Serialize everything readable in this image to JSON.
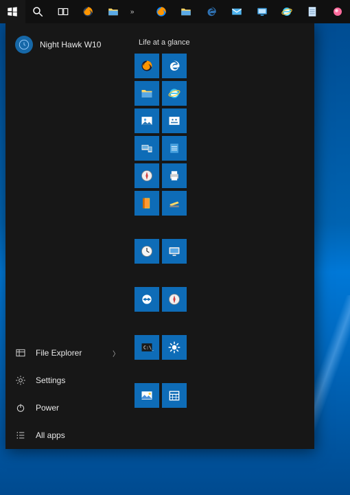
{
  "taskbar": {
    "items": [
      {
        "name": "start-button",
        "icon": "windows"
      },
      {
        "name": "search-button",
        "icon": "search"
      },
      {
        "name": "taskview-button",
        "icon": "taskview"
      }
    ],
    "apps": [
      {
        "name": "tb-firefox",
        "icon": "firefox"
      },
      {
        "name": "tb-fileexplorer",
        "icon": "folder"
      }
    ],
    "overflow": "»",
    "pinned": [
      {
        "name": "tb-firefox-2",
        "icon": "firefox-blue"
      },
      {
        "name": "tb-fileexplorer-2",
        "icon": "folder"
      },
      {
        "name": "tb-edge",
        "icon": "edge"
      },
      {
        "name": "tb-mail",
        "icon": "mail"
      },
      {
        "name": "tb-monitor",
        "icon": "monitor"
      },
      {
        "name": "tb-ie",
        "icon": "ie"
      },
      {
        "name": "tb-notes",
        "icon": "notepad"
      },
      {
        "name": "tb-util",
        "icon": "orb"
      }
    ]
  },
  "start": {
    "user": "Night Hawk W10",
    "items": {
      "fileExplorer": "File Explorer",
      "settings": "Settings",
      "power": "Power",
      "allApps": "All apps"
    },
    "groupTitle": "Life at a glance",
    "tiles": [
      [
        {
          "name": "tile-firefox",
          "icon": "firefox-dark"
        },
        {
          "name": "tile-edge",
          "icon": "edge"
        }
      ],
      [
        {
          "name": "tile-fileexplorer",
          "icon": "folder"
        },
        {
          "name": "tile-ie",
          "icon": "ie"
        }
      ],
      [
        {
          "name": "tile-photos",
          "icon": "photos"
        },
        {
          "name": "tile-control",
          "icon": "control"
        }
      ],
      [
        {
          "name": "tile-devices",
          "icon": "devices"
        },
        {
          "name": "tile-notepadblue",
          "icon": "notepadblue"
        }
      ],
      [
        {
          "name": "tile-compass",
          "icon": "compass"
        },
        {
          "name": "tile-printer",
          "icon": "printer"
        }
      ],
      [
        {
          "name": "tile-book",
          "icon": "book"
        },
        {
          "name": "tile-stapler",
          "icon": "stapler"
        }
      ],
      "gap",
      [
        {
          "name": "tile-clock",
          "icon": "clock"
        },
        {
          "name": "tile-monitor",
          "icon": "monitorwhite"
        }
      ],
      "gap",
      [
        {
          "name": "tile-teamviewer",
          "icon": "teamviewer"
        },
        {
          "name": "tile-compass2",
          "icon": "compass"
        }
      ],
      "gap",
      [
        {
          "name": "tile-cmd",
          "icon": "cmd"
        },
        {
          "name": "tile-weather",
          "icon": "sun"
        }
      ],
      "gap",
      [
        {
          "name": "tile-picture",
          "icon": "picture"
        },
        {
          "name": "tile-calendar",
          "icon": "calendar"
        }
      ]
    ]
  }
}
